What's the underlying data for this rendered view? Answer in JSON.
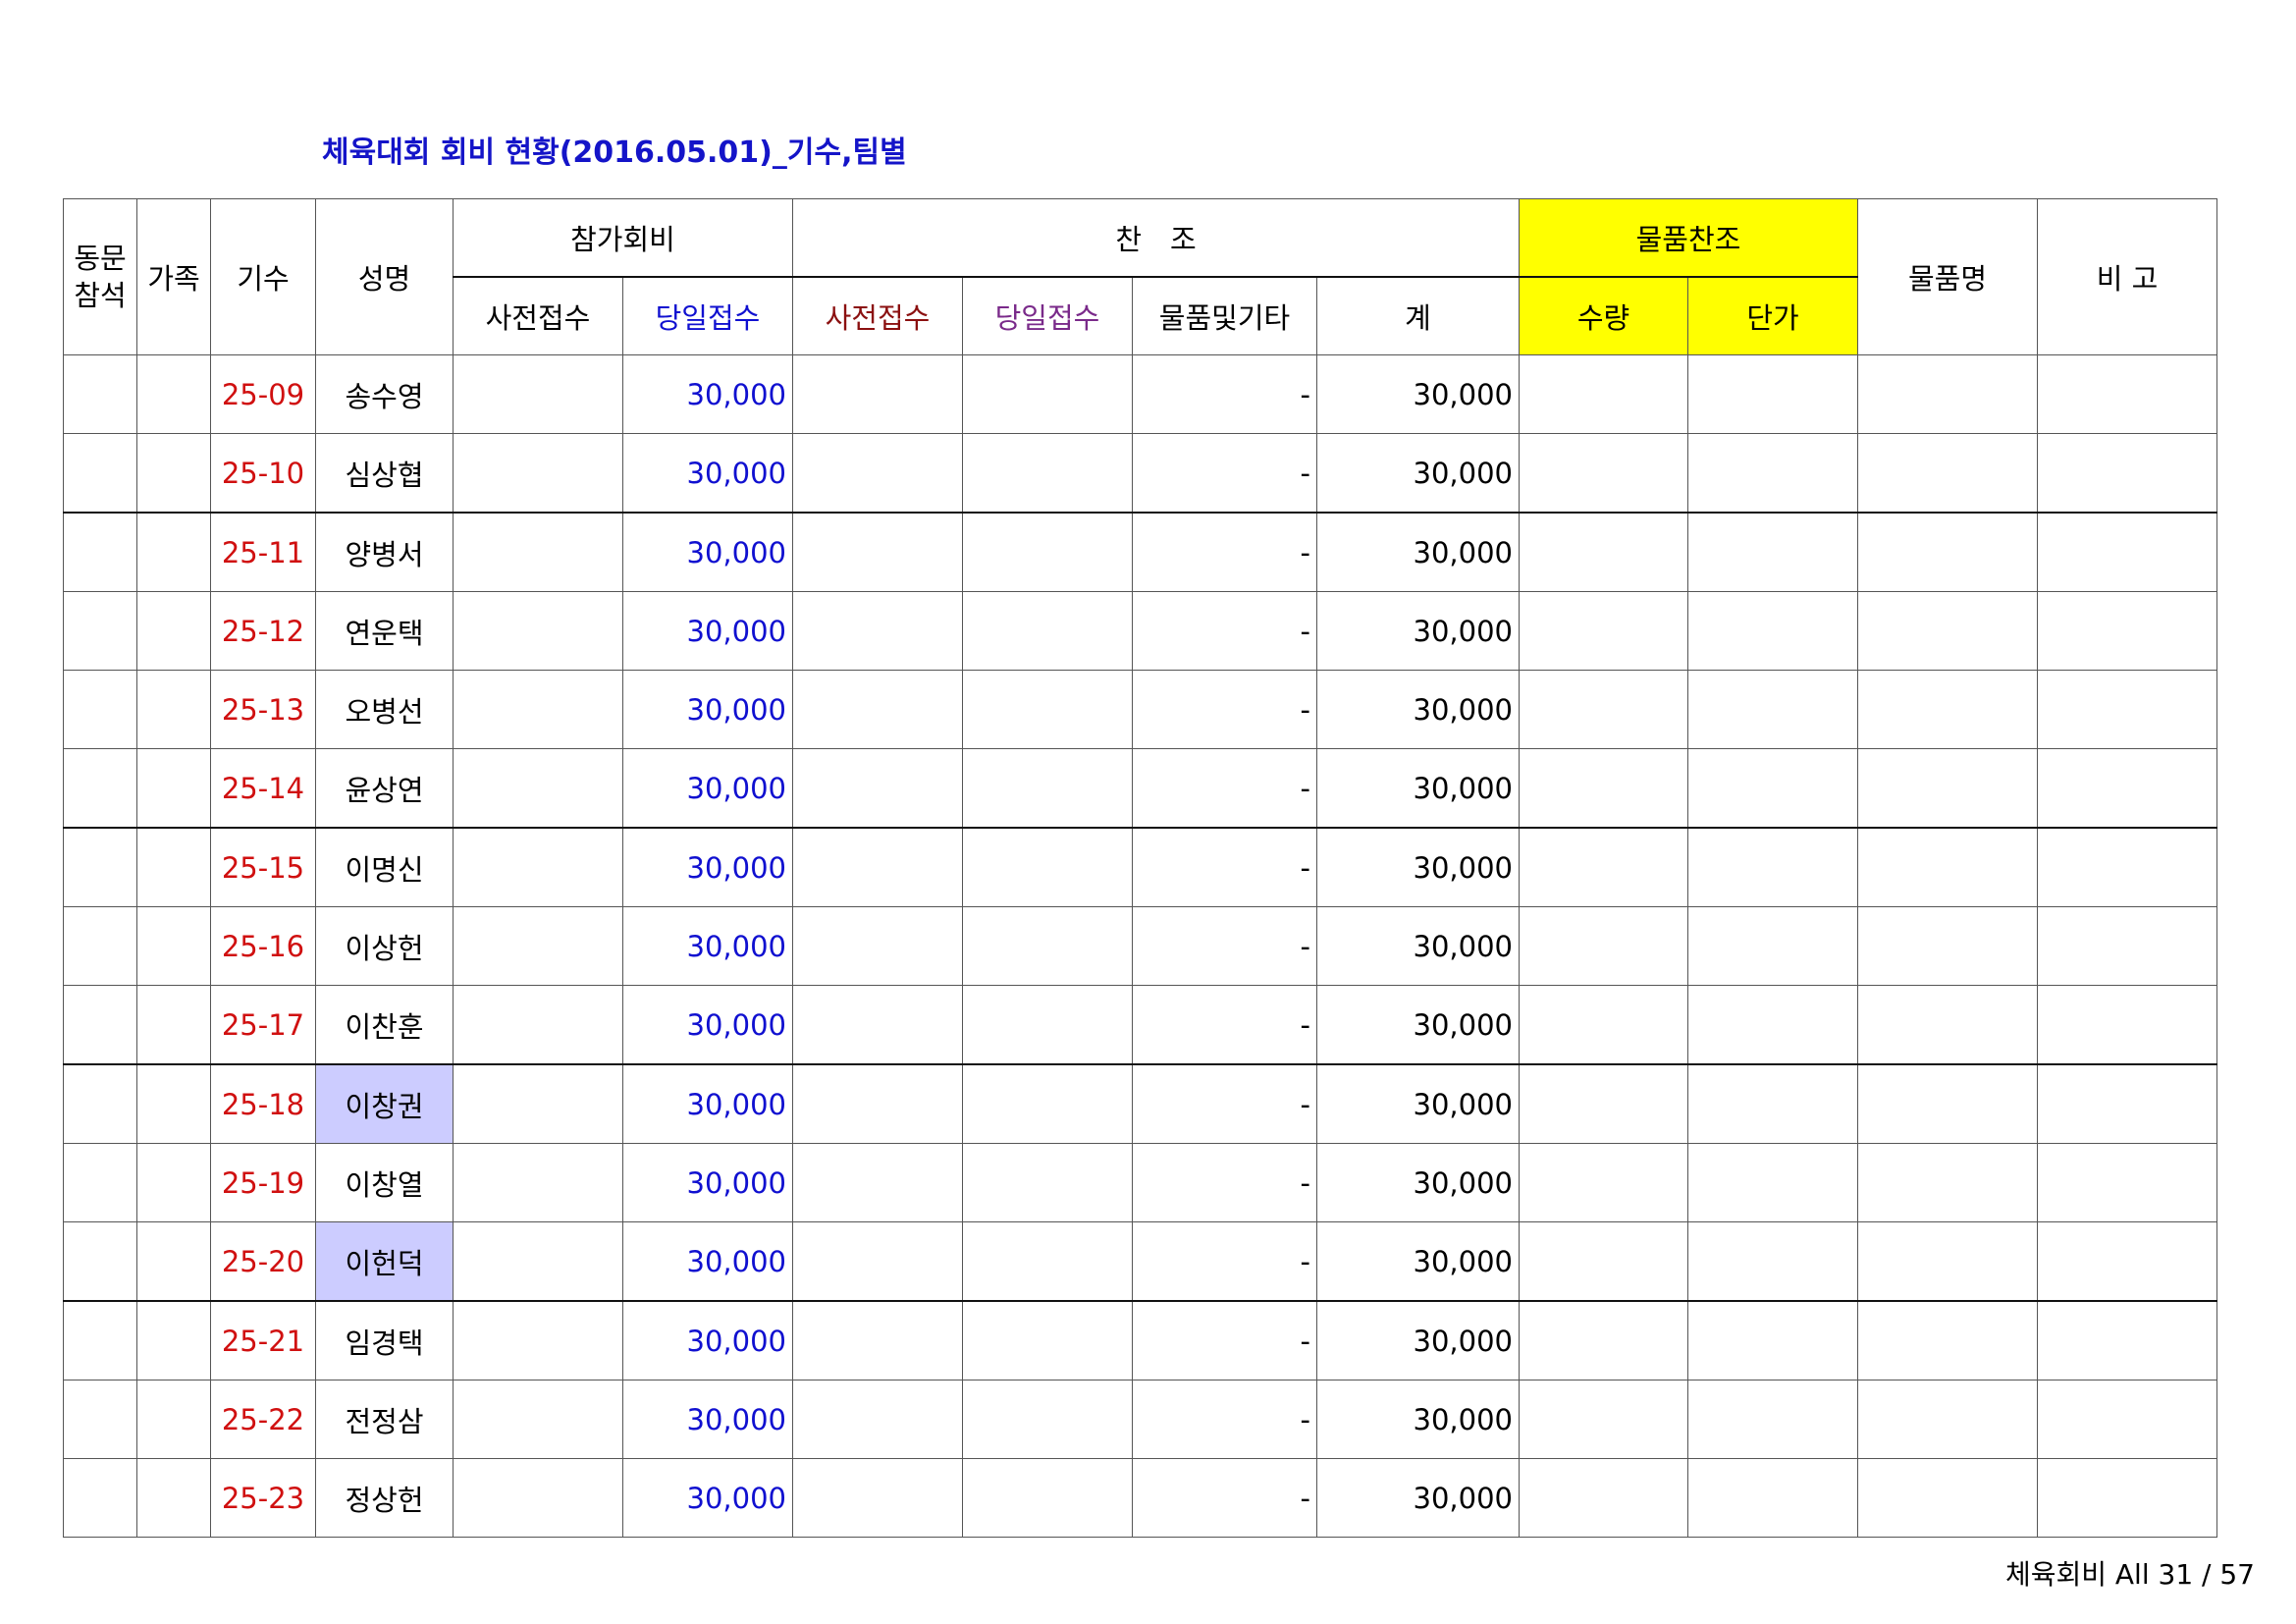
{
  "title": "체육대회 회비 현황(2016.05.01)_기수,팀별",
  "header": {
    "alumni_attend_line1": "동문",
    "alumni_attend_line2": "참석",
    "family": "가족",
    "cohort": "기수",
    "name": "성명",
    "participation_fee": "참가회비",
    "sponsorship": "찬　조",
    "goods_sponsorship": "물품찬조",
    "item_name": "물품명",
    "remarks": "비 고",
    "fee_advance": "사전접수",
    "fee_same_day": "당일접수",
    "sponsor_advance": "사전접수",
    "sponsor_same_day": "당일접수",
    "goods_and_other": "물품및기타",
    "total": "계",
    "quantity": "수량",
    "unit_price": "단가"
  },
  "rows": [
    {
      "cohort": "25-09",
      "name": "송수영",
      "same_day": "30,000",
      "goods": "-",
      "total": "30,000"
    },
    {
      "cohort": "25-10",
      "name": "심상협",
      "same_day": "30,000",
      "goods": "-",
      "total": "30,000"
    },
    {
      "cohort": "25-11",
      "name": "양병서",
      "same_day": "30,000",
      "goods": "-",
      "total": "30,000"
    },
    {
      "cohort": "25-12",
      "name": "연운택",
      "same_day": "30,000",
      "goods": "-",
      "total": "30,000"
    },
    {
      "cohort": "25-13",
      "name": "오병선",
      "same_day": "30,000",
      "goods": "-",
      "total": "30,000"
    },
    {
      "cohort": "25-14",
      "name": "윤상연",
      "same_day": "30,000",
      "goods": "-",
      "total": "30,000"
    },
    {
      "cohort": "25-15",
      "name": "이명신",
      "same_day": "30,000",
      "goods": "-",
      "total": "30,000"
    },
    {
      "cohort": "25-16",
      "name": "이상헌",
      "same_day": "30,000",
      "goods": "-",
      "total": "30,000"
    },
    {
      "cohort": "25-17",
      "name": "이찬훈",
      "same_day": "30,000",
      "goods": "-",
      "total": "30,000"
    },
    {
      "cohort": "25-18",
      "name": "이창권",
      "same_day": "30,000",
      "goods": "-",
      "total": "30,000"
    },
    {
      "cohort": "25-19",
      "name": "이창열",
      "same_day": "30,000",
      "goods": "-",
      "total": "30,000"
    },
    {
      "cohort": "25-20",
      "name": "이헌덕",
      "same_day": "30,000",
      "goods": "-",
      "total": "30,000"
    },
    {
      "cohort": "25-21",
      "name": "임경택",
      "same_day": "30,000",
      "goods": "-",
      "total": "30,000"
    },
    {
      "cohort": "25-22",
      "name": "전정삼",
      "same_day": "30,000",
      "goods": "-",
      "total": "30,000"
    },
    {
      "cohort": "25-23",
      "name": "정상헌",
      "same_day": "30,000",
      "goods": "-",
      "total": "30,000"
    }
  ],
  "footer": "체육회비 All 31 / 57",
  "colors": {
    "title": "#1414c8",
    "highlight_yellow": "#ffff00",
    "highlight_name": "#ccccff",
    "cohort_text": "#d01010",
    "amount_text": "#1010d0"
  }
}
